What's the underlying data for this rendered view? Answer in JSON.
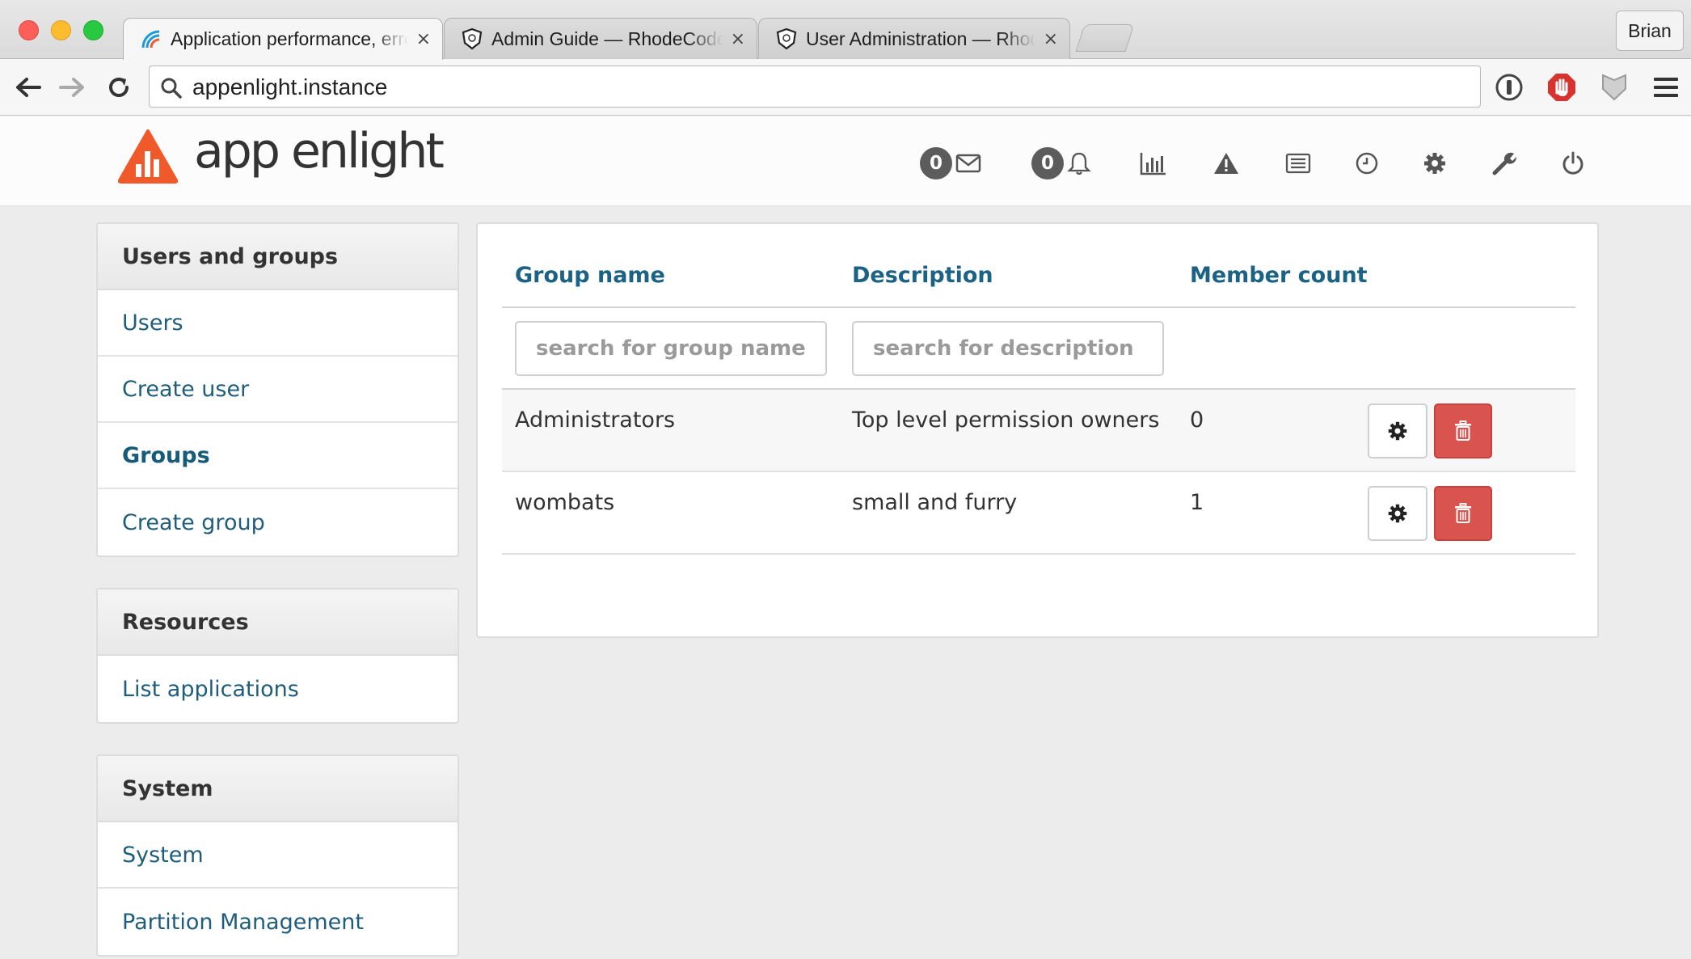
{
  "browser": {
    "tabs": [
      {
        "title": "Application performance, error and log monitoring",
        "close": "×",
        "favicon": "appenlight-favicon",
        "active": true
      },
      {
        "title": "Admin Guide — RhodeCode",
        "close": "×",
        "favicon": "rhodecode-shield-favicon",
        "active": false
      },
      {
        "title": "User Administration — RhodeCode",
        "close": "×",
        "favicon": "rhodecode-shield-favicon",
        "active": false
      }
    ],
    "profile_name": "Brian",
    "url": "appenlight.instance"
  },
  "app": {
    "logo_text": "app enlight",
    "header": {
      "messages_count": "0",
      "notifications_count": "0",
      "icons": [
        "envelope-icon",
        "bell-icon",
        "bar-chart-icon",
        "warning-icon",
        "list-icon",
        "clock-icon",
        "gear-icon",
        "wrench-icon",
        "power-icon"
      ]
    },
    "colors": {
      "accent_link": "#1f5d7a",
      "logo_orange": "#f0592a",
      "danger": "#d9534f"
    }
  },
  "sidebar": {
    "users_and_groups": {
      "heading": "Users and groups",
      "items": [
        "Users",
        "Create user",
        "Groups",
        "Create group"
      ],
      "active": "Groups"
    },
    "resources": {
      "heading": "Resources",
      "items": [
        "List applications"
      ]
    },
    "system": {
      "heading": "System",
      "items": [
        "System",
        "Partition Management"
      ]
    }
  },
  "groups_table": {
    "columns": [
      "Group name",
      "Description",
      "Member count"
    ],
    "filters": {
      "group_name_placeholder": "search for group name",
      "description_placeholder": "search for description"
    },
    "rows": [
      {
        "name": "Administrators",
        "description": "Top level permission owners",
        "member_count": "0"
      },
      {
        "name": "wombats",
        "description": "small and furry",
        "member_count": "1"
      }
    ]
  }
}
